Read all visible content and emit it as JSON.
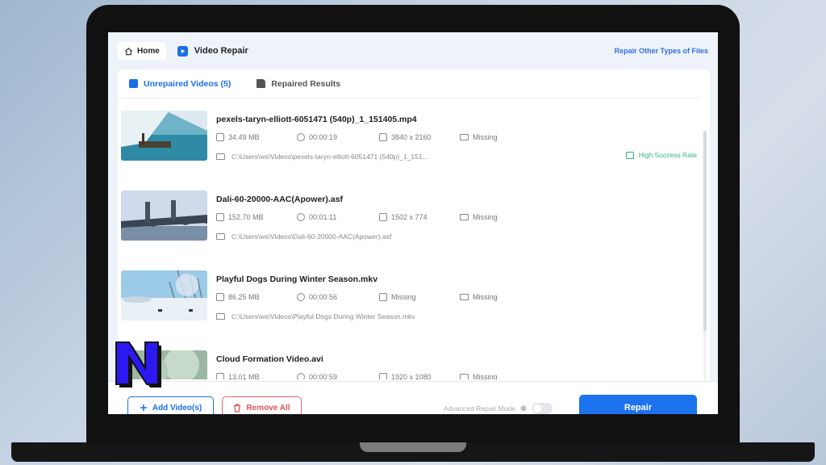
{
  "header": {
    "home_label": "Home",
    "app_title": "Video Repair",
    "repair_other_link": "Repair Other Types of Files"
  },
  "tabs": [
    {
      "label": "Unrepaired Videos (5)",
      "active": true
    },
    {
      "label": "Repaired Results",
      "active": false
    }
  ],
  "videos": [
    {
      "name": "pexels-taryn-elliott-6051471 (540p)_1_151405.mp4",
      "size": "34.49 MB",
      "duration": "00:00:19",
      "resolution": "3840 x 2160",
      "audio": "Missing",
      "path": "C:\\Users\\ws\\Videos\\pexels-taryn-elliott-6051471 (540p)_1_151...",
      "badge": "High Success Rate"
    },
    {
      "name": "Dali-60-20000-AAC(Apower).asf",
      "size": "152.70 MB",
      "duration": "00:01:11",
      "resolution": "1502 x 774",
      "audio": "Missing",
      "path": "C:\\Users\\ws\\Videos\\Dali-60-20000-AAC(Apower).asf"
    },
    {
      "name": "Playful Dogs During Winter Season.mkv",
      "size": "86.25 MB",
      "duration": "00:00:56",
      "resolution": "Missing",
      "audio": "Missing",
      "path": "C:\\Users\\ws\\Videos\\Playful Dogs During Winter Season.mkv"
    },
    {
      "name": "Cloud Formation Video.avi",
      "size": "13.01 MB",
      "duration": "00:00:59",
      "resolution": "1920 x 1080",
      "audio": "Missing"
    }
  ],
  "footer": {
    "add_label": "Add Video(s)",
    "remove_label": "Remove All",
    "advanced_label": "Advanced Repair Mode",
    "repair_label": "Repair"
  },
  "colors": {
    "accent": "#1b6fe8",
    "danger": "#e05555",
    "success": "#32b47a"
  }
}
